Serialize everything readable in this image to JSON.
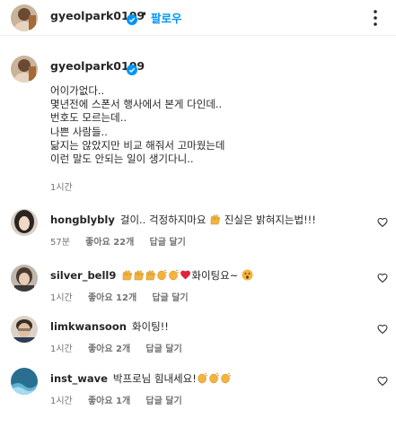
{
  "header": {
    "username": "gyeolpark0109",
    "separator": "•",
    "follow_label": "팔로우"
  },
  "caption": {
    "username": "gyeolpark0109",
    "separator": ".",
    "text": "어이가없다..\n몇년전에 스폰서 행사에서 본게 다인데..\n번호도 모르는데..\n나쁜 사람들..\n닮지는 않았지만 비교 해줘서 고마웠는데\n이런 말도 안되는 일이 생기다니..",
    "time": "1시간"
  },
  "comments": [
    {
      "username": "hongblybly",
      "text_a": "걸이.. 걱정하지마요",
      "text_b": "진실은 밝혀지는법!!!",
      "time": "57분",
      "likes": "좋아요 22개",
      "reply": "답글 달기"
    },
    {
      "username": "silver_bell9",
      "text_a": "화이팅요~",
      "time": "1시간",
      "likes": "좋아요 12개",
      "reply": "답글 달기"
    },
    {
      "username": "limkwansoon",
      "text_a": "화이팅!!",
      "time": "1시간",
      "likes": "좋아요 2개",
      "reply": "답글 달기"
    },
    {
      "username": "inst_wave",
      "text_a": "박프로님 힘내세요!",
      "time": "1시간",
      "likes": "좋아요 1개",
      "reply": "답글 달기"
    }
  ],
  "colors": {
    "accent": "#0095f6",
    "muted": "#737373",
    "text": "#262626",
    "heart_red": "#ed4956"
  },
  "icons": {
    "verified": "verified-badge-icon",
    "more": "more-options-icon",
    "like": "heart-outline-icon"
  }
}
